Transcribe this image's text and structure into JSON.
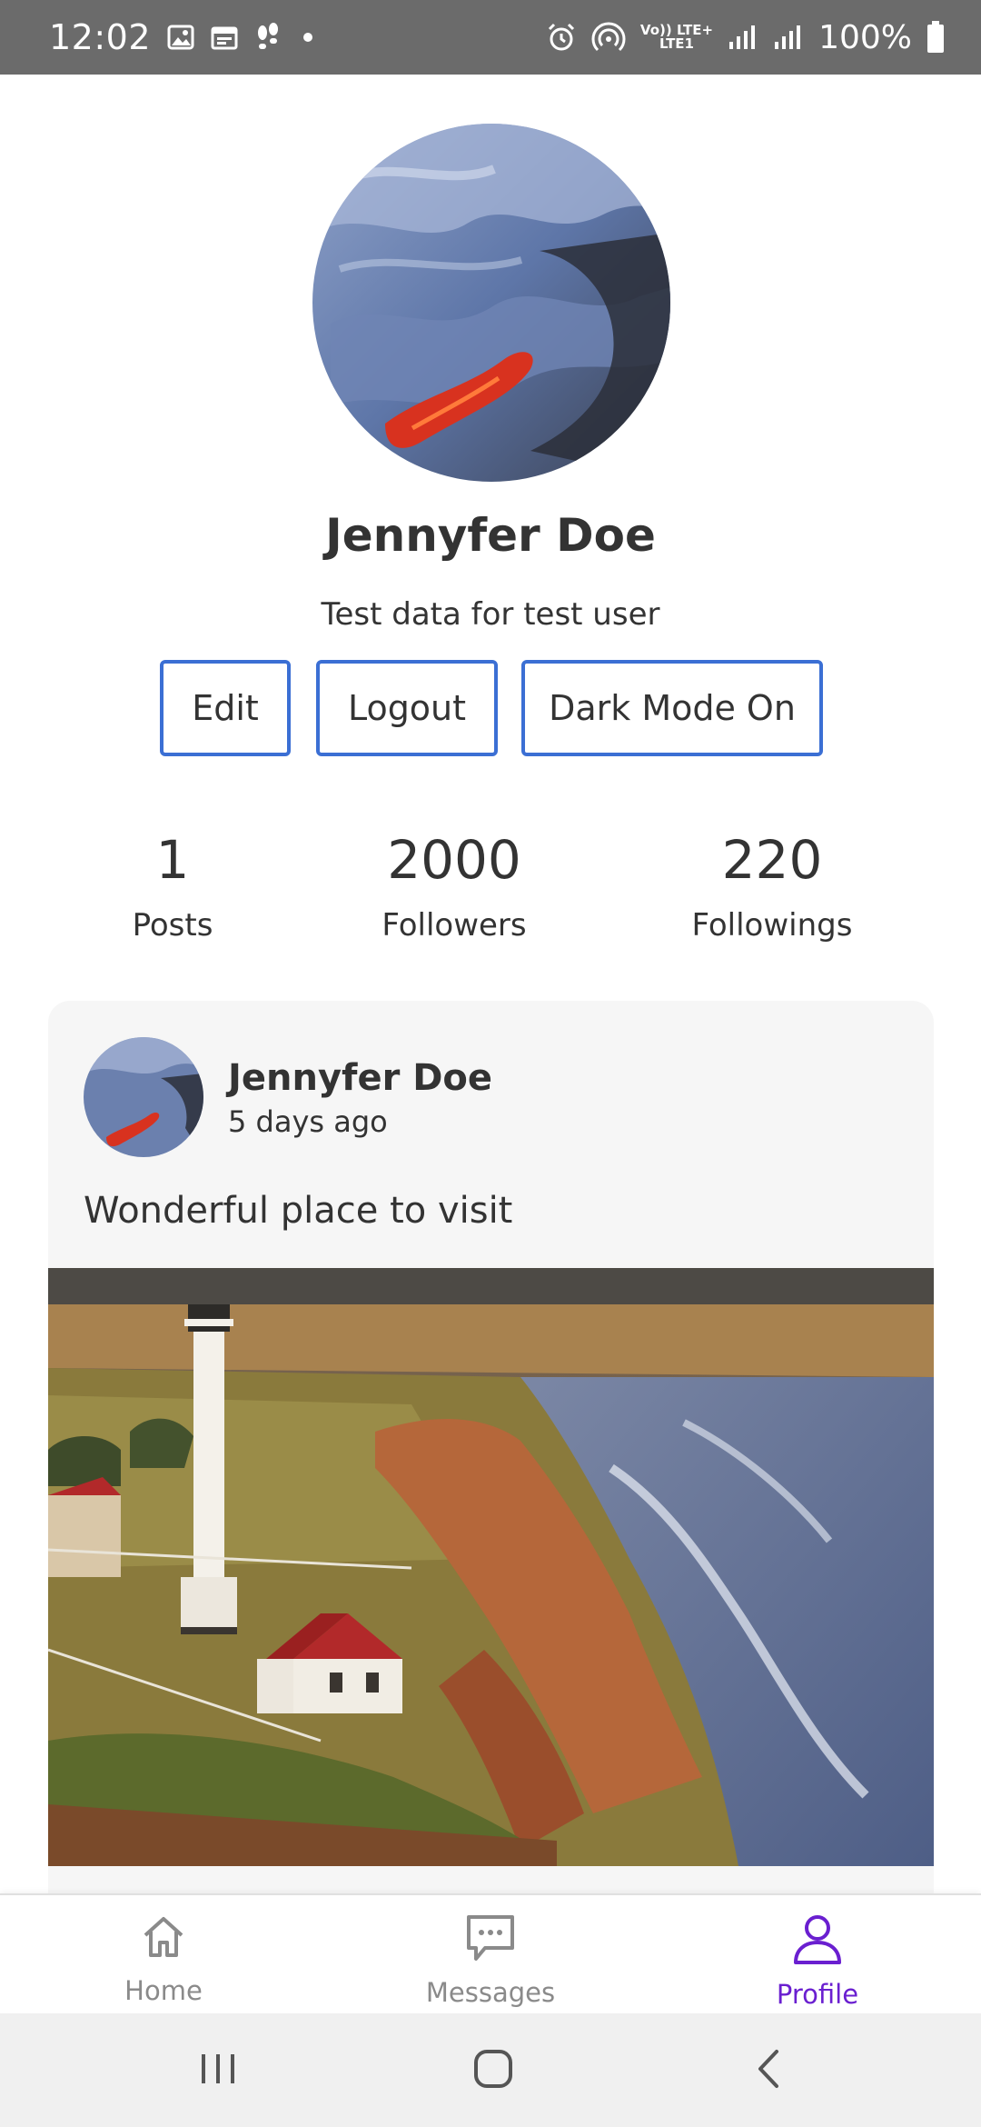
{
  "status_bar": {
    "time": "12:02",
    "network_top": "Vo)) LTE+",
    "network_bottom": "LTE1",
    "battery": "100%"
  },
  "profile": {
    "name": "Jennyfer Doe",
    "bio": "Test data for test user",
    "buttons": {
      "edit": "Edit",
      "logout": "Logout",
      "dark_mode": "Dark Mode On"
    },
    "stats": [
      {
        "value": "1",
        "label": "Posts"
      },
      {
        "value": "2000",
        "label": "Followers"
      },
      {
        "value": "220",
        "label": "Followings"
      }
    ]
  },
  "post": {
    "author": "Jennyfer Doe",
    "time": "5 days ago",
    "text": "Wonderful place to visit"
  },
  "bottom_nav": {
    "items": [
      {
        "label": "Home",
        "icon": "home-icon"
      },
      {
        "label": "Messages",
        "icon": "message-icon"
      },
      {
        "label": "Profile",
        "icon": "person-icon"
      }
    ],
    "active": "Profile",
    "active_color": "#6a1fd0"
  },
  "colors": {
    "button_border": "#3b6fd4",
    "status_bar": "#6b6b6b"
  }
}
